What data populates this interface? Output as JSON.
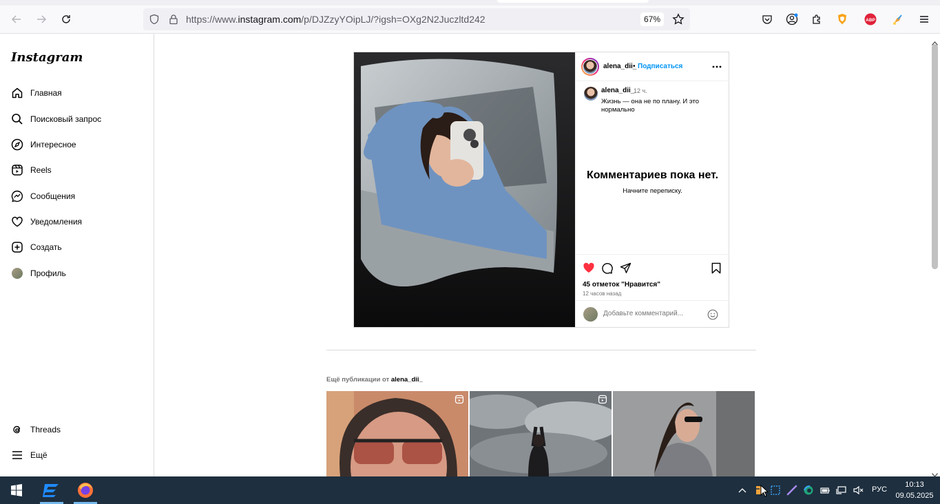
{
  "browser": {
    "url_prefix": "https://www.",
    "url_domain": "instagram.com",
    "url_path": "/p/DJZzyYOipLJ/?igsh=OXg2N2Juczltd242",
    "zoom": "67%"
  },
  "sidebar": {
    "logo": "Instagram",
    "items": [
      {
        "label": "Главная",
        "icon": "home-icon"
      },
      {
        "label": "Поисковый запрос",
        "icon": "search-icon"
      },
      {
        "label": "Интересное",
        "icon": "compass-icon"
      },
      {
        "label": "Reels",
        "icon": "reels-icon"
      },
      {
        "label": "Сообщения",
        "icon": "messenger-icon"
      },
      {
        "label": "Уведомления",
        "icon": "heart-icon"
      },
      {
        "label": "Создать",
        "icon": "plus-icon"
      },
      {
        "label": "Профиль",
        "icon": "avatar"
      }
    ],
    "bottom": [
      {
        "label": "Threads",
        "icon": "threads-icon"
      },
      {
        "label": "Ещё",
        "icon": "menu-icon"
      }
    ]
  },
  "post": {
    "username": "alena_dii_",
    "separator": "•",
    "follow": "Подписаться",
    "caption_user": "alena_dii_",
    "caption_time": "12 ч.",
    "caption_text": "Жизнь — она не по плану. И это нормально",
    "no_comments_title": "Комментариев пока нет.",
    "no_comments_sub": "Начните переписку.",
    "likes": "45 отметок \"Нравится\"",
    "posted_ago": "12 часов назад",
    "comment_placeholder": "Добавьте комментарий..."
  },
  "more_posts": {
    "label_prefix": "Ещё публикации от",
    "label_user": "alena_dii_"
  },
  "taskbar": {
    "language": "РУС",
    "time": "10:13",
    "date": "09.05.2025"
  },
  "colors": {
    "like_red": "#ff3040",
    "follow_blue": "#0095f6",
    "taskbar_bg": "#1e2f3f"
  }
}
